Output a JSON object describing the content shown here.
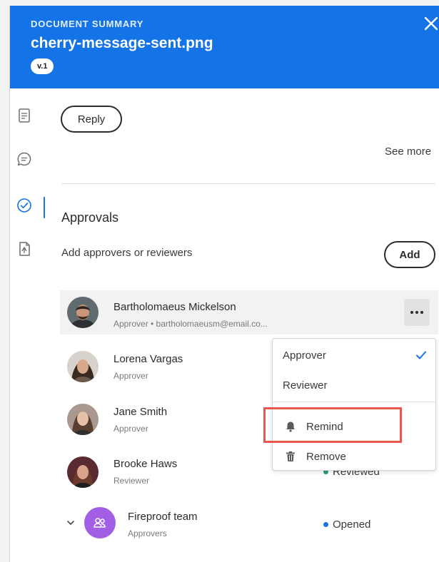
{
  "header": {
    "eyebrow": "DOCUMENT SUMMARY",
    "filename": "cherry-message-sent.png",
    "version": "v.1"
  },
  "rail": {
    "items": [
      "document-icon",
      "comment-icon",
      "approval-check-icon",
      "file-compare-icon"
    ],
    "active": "approval-check-icon"
  },
  "actions": {
    "reply_label": "Reply",
    "see_more_label": "See more",
    "add_label": "Add"
  },
  "approvals": {
    "title": "Approvals",
    "subtitle": "Add approvers or reviewers",
    "people": [
      {
        "name": "Bartholomaeus Mickelson",
        "role": "Approver • bartholomaeusm@email.co...",
        "status": ""
      },
      {
        "name": "Lorena Vargas",
        "role": "Approver",
        "status": ""
      },
      {
        "name": "Jane Smith",
        "role": "Approver",
        "status": ""
      },
      {
        "name": "Brooke Haws",
        "role": "Reviewer",
        "status": "Reviewed"
      },
      {
        "name": "Fireproof team",
        "role": "Approvers",
        "status": "Opened"
      }
    ]
  },
  "menu": {
    "approver": "Approver",
    "reviewer": "Reviewer",
    "remind": "Remind",
    "remove": "Remove",
    "selected": "Approver"
  },
  "colors": {
    "accent": "#1473e6",
    "highlight_box": "#e8574e",
    "reviewed_dot": "#2d9d78",
    "opened_dot": "#1473e6",
    "team_avatar": "#a25ee5"
  }
}
